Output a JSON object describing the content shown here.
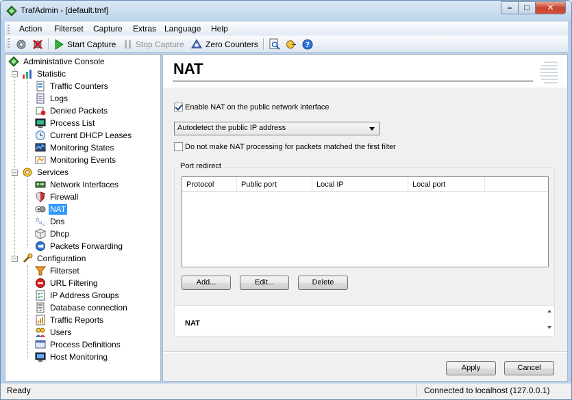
{
  "window": {
    "title": "TrafAdmin - [default.tmf]"
  },
  "menu": [
    "Action",
    "Filterset",
    "Capture",
    "Extras",
    "Language",
    "Help"
  ],
  "toolbar": {
    "start_capture": "Start Capture",
    "stop_capture": "Stop Capture",
    "zero_counters": "Zero Counters"
  },
  "tree": {
    "root": "Administative Console",
    "statistic": {
      "label": "Statistic",
      "items": [
        "Traffic Counters",
        "Logs",
        "Denied Packets",
        "Process List",
        "Current DHCP Leases",
        "Monitoring States",
        "Monitoring Events"
      ]
    },
    "services": {
      "label": "Services",
      "items": [
        "Network Interfaces",
        "Firewall",
        "NAT",
        "Dns",
        "Dhcp",
        "Packets Forwarding"
      ]
    },
    "configuration": {
      "label": "Configuration",
      "items": [
        "Filterset",
        "URL Filtering",
        "IP Address Groups",
        "Database connection",
        "Traffic Reports",
        "Users",
        "Process Definitions",
        "Host Monitoring"
      ]
    },
    "selected": "NAT"
  },
  "page": {
    "title": "NAT",
    "enable_nat_label": "Enable NAT on the public network interface",
    "enable_nat_checked": true,
    "ip_select_value": "Autodetect the public IP address",
    "no_nat_label": "Do not make NAT processing for packets matched the first filter",
    "no_nat_checked": false,
    "port_redirect_label": "Port redirect",
    "columns": [
      "Protocol",
      "Public port",
      "Local IP",
      "Local port"
    ],
    "rows": [],
    "add_label": "Add...",
    "edit_label": "Edit...",
    "delete_label": "Delete",
    "description": "NAT",
    "apply_label": "Apply",
    "cancel_label": "Cancel"
  },
  "status": {
    "left": "Ready",
    "right": "Connected to localhost (127.0.0.1)"
  }
}
